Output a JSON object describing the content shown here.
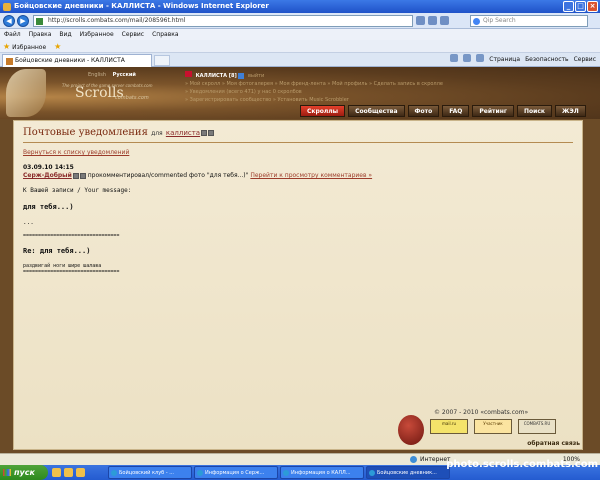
{
  "window": {
    "title": "Бойцовские дневники - КАЛЛИСТА - Windows Internet Explorer"
  },
  "browser": {
    "url": "http://scrolls.combats.com/mail/208596t.html",
    "search_placeholder": "Qip Search",
    "menu": [
      "Файл",
      "Правка",
      "Вид",
      "Избранное",
      "Сервис",
      "Справка"
    ],
    "favorites_label": "Избранное",
    "tab_label": "Бойцовские дневники - КАЛЛИСТА",
    "commands": [
      "Страница",
      "Безопасность",
      "Сервис"
    ]
  },
  "site": {
    "languages": [
      "English",
      "Русский"
    ],
    "active_language": "Русский",
    "logo": "Scrolls",
    "logo_sub": "The project of the game server combats.com",
    "logo_domain": "combats.com",
    "user": {
      "name": "КАЛЛИСТА [8]",
      "logout": "выйти"
    },
    "user_links": [
      "» Мой скролл » Моя фотогалерея » Моя френд-лента » Мой профиль » Сделать запись в скролле",
      "» Уведомления (всего 471) у нас 0 скролбов",
      "» Зарегистрировать сообщество » Установить Music Scrobbler"
    ],
    "nav": [
      "Скроллы",
      "Сообщества",
      "Фото",
      "FAQ",
      "Рейтинг",
      "Поиск",
      "ЖЭЛ"
    ],
    "active_nav": "Скроллы"
  },
  "page": {
    "title": "Почтовые уведомления",
    "title_for": "для",
    "title_user": "каллиста",
    "back_link": "Вернуться к списку уведомлений",
    "date": "03.09.10 14:15",
    "sender": "Серж-Добрый",
    "action": "прокомментировал/commented фото \"для тебя...)\"",
    "goto_link": "Перейти к просмотру комментариев »",
    "message_label": "К Вашей записи / Your message:",
    "message_text": "для тебя...)",
    "ellipsis": "...",
    "separator": "================================",
    "reply_title": "Re: для тебя...)",
    "reply_text": "раздвигай ноги шире шалава",
    "separator2": "================================"
  },
  "footer": {
    "copyright": "© 2007 - 2010 «combats.com»",
    "badges": [
      "mail.ru",
      "Участник",
      "COMBATS.RU"
    ],
    "feedback": "обратная связь"
  },
  "statusbar": {
    "zone": "Интернет",
    "zoom": "100%"
  },
  "taskbar": {
    "start": "пуск",
    "tasks": [
      "Бойцовский клуб - ...",
      "Информация о Серж...",
      "Информация о КАЛЛ...",
      "Бойцовские дневник..."
    ],
    "watermark": "photo.scrolls.combats.com"
  }
}
